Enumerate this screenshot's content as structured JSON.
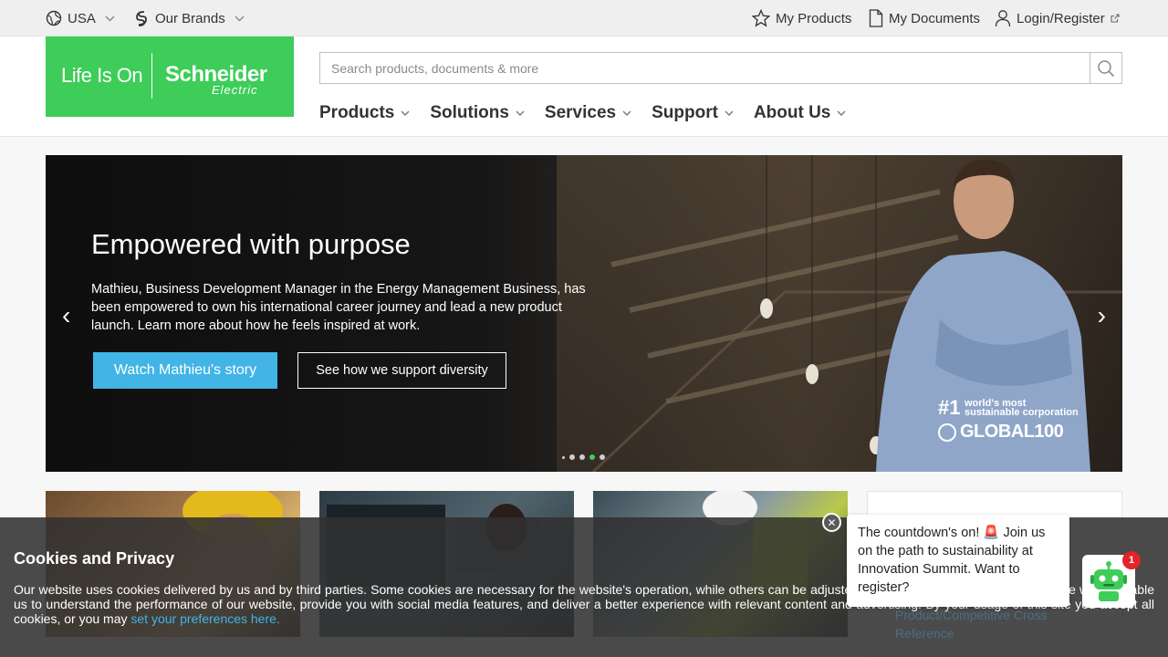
{
  "utility": {
    "country": "USA",
    "brands": "Our Brands",
    "my_products": "My Products",
    "my_documents": "My Documents",
    "login": "Login/Register"
  },
  "header": {
    "logo_tagline": "Life Is On",
    "logo_brand": "Schneider",
    "logo_brand_sub": "Electric",
    "search_placeholder": "Search products, documents & more",
    "nav": [
      "Products",
      "Solutions",
      "Services",
      "Support",
      "About Us"
    ]
  },
  "hero": {
    "title": "Empowered with purpose",
    "description": "Mathieu, Business Development Manager in the Energy Management Business, has been empowered to own his international career journey and lead a new product launch. Learn more about how he feels inspired at work.",
    "primary_button": "Watch Mathieu's story",
    "secondary_button": "See how we support diversity",
    "prev_arrow": "‹",
    "next_arrow": "›",
    "badge_number": "#1",
    "badge_line1": "world's most",
    "badge_line2": "sustainable corporation",
    "badge_global": "GLOBAL100",
    "slide_count": 5,
    "active_slide": 4
  },
  "cookie": {
    "title": "Cookies and Privacy",
    "text": "Our website uses cookies delivered by us and by third parties. Some cookies are necessary for the website's operation, while others can be adjusted by you at any time, in particular those which enable us to understand the performance of our website, provide you with social media features, and deliver a better experience with relevant content and advertising. By your usage of this site you accept all cookies, or you may ",
    "link": "set your preferences here."
  },
  "side_panel": {
    "link_text": "Product/Competitive Cross Reference"
  },
  "chat": {
    "message": "The countdown's on! 🚨 Join us on the path to sustainability at Innovation Summit. Want to register?",
    "close": "✕",
    "badge_count": "1"
  },
  "colors": {
    "brand_green": "#3dcd58",
    "accent_blue": "#42b4e6",
    "alert_red": "#e4232a"
  }
}
